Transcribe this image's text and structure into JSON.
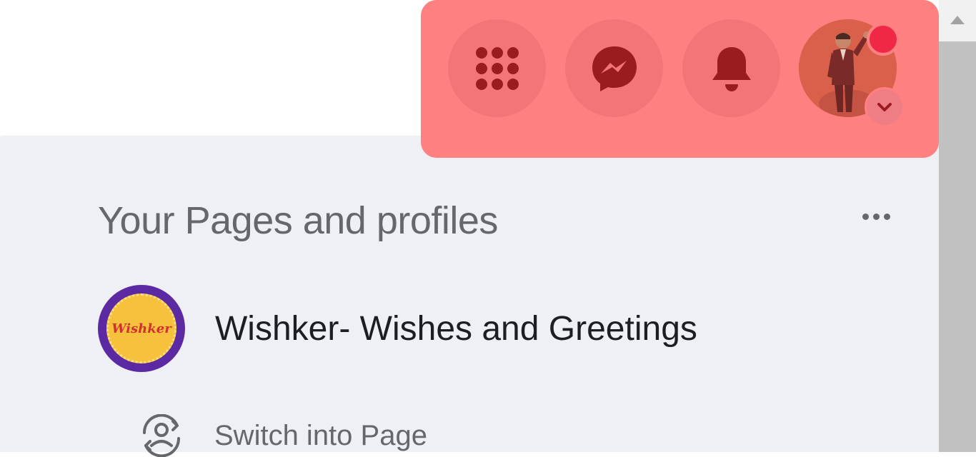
{
  "header": {
    "menu_icon": "grid-menu-icon",
    "messenger_icon": "messenger-icon",
    "notifications_icon": "bell-icon",
    "account_icon": "profile-avatar",
    "account_chevron": "chevron-down-icon"
  },
  "colors": {
    "highlight": "#ff8080",
    "icon_dark": "#9b1c1f",
    "badge_red": "#ef2845",
    "content_bg": "#eff0f5"
  },
  "pages": {
    "title": "Your Pages and profiles",
    "more_icon": "more-horizontal-icon",
    "items": [
      {
        "name": "Wishker- Wishes and Greetings",
        "logo_text": "Wishker"
      }
    ],
    "switch_label": "Switch into Page",
    "switch_icon": "switch-profile-icon"
  }
}
